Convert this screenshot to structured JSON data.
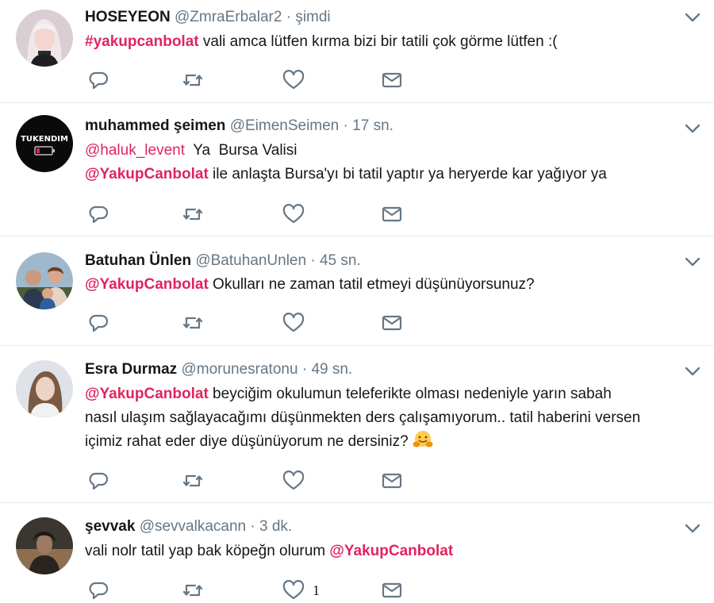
{
  "colors": {
    "name": "#14171a",
    "meta": "#657786",
    "mention": "#e0245e",
    "icon": "#657786",
    "divider": "#e6ecf0"
  },
  "tweets": [
    {
      "name": "HOSEYEON",
      "handle": "@ZmraErbalar2",
      "dot": "·",
      "time": "şimdi",
      "line1": {
        "m1": "#yakupcanbolat",
        "t1": " vali amca lütfen kırma bizi bir tatili çok görme lütfen :("
      },
      "icons": [
        "reply-icon",
        "retweet-icon",
        "like-icon",
        "dm-icon"
      ]
    },
    {
      "name": "muhammed şeimen",
      "handle": "@EimenSeimen",
      "dot": "·",
      "time": "17 sn.",
      "avatar_text": "TUKENDIM",
      "line1": {
        "m1": "@haluk_levent",
        "t1": "  Ya  Bursa Valisi"
      },
      "line2": {
        "m1": "@YakupCanbolat",
        "t1": " ile anlaşta Bursa'yı bi tatil yaptır ya heryerde kar yağıyor ya"
      },
      "icons": [
        "reply-icon",
        "retweet-icon",
        "like-icon",
        "dm-icon"
      ]
    },
    {
      "name": "Batuhan Ünlen",
      "handle": "@BatuhanUnlen",
      "dot": "·",
      "time": "45 sn.",
      "line1": {
        "m1": "@YakupCanbolat",
        "t1": " Okulları ne zaman tatil etmeyi düşünüyorsunuz?"
      },
      "icons": [
        "reply-icon",
        "retweet-icon",
        "like-icon",
        "dm-icon"
      ]
    },
    {
      "name": "Esra Durmaz",
      "handle": "@morunesratonu",
      "dot": "·",
      "time": "49 sn.",
      "line1": {
        "m1": "@YakupCanbolat",
        "t1": " beyciğim okulumun teleferikte olması nedeniyle yarın sabah"
      },
      "line2": {
        "t1": "nasıl ulaşım sağlayacağımı düşünmekten ders çalışamıyorum.. tatil haberini versen"
      },
      "line3": {
        "t1": "içimiz rahat eder diye düşünüyorum ne dersiniz? "
      },
      "emoji": "hugging-face-emoji",
      "icons": [
        "reply-icon",
        "retweet-icon",
        "like-icon",
        "dm-icon"
      ]
    },
    {
      "name": "şevvak",
      "handle": "@sevvalkacann",
      "dot": "·",
      "time": "3 dk.",
      "line1": {
        "t1": "vali nolr tatil yap bak köpeğn olurum ",
        "m1": "@YakupCanbolat"
      },
      "like_count": "1",
      "icons": [
        "reply-icon",
        "retweet-icon",
        "like-icon",
        "dm-icon"
      ]
    }
  ]
}
